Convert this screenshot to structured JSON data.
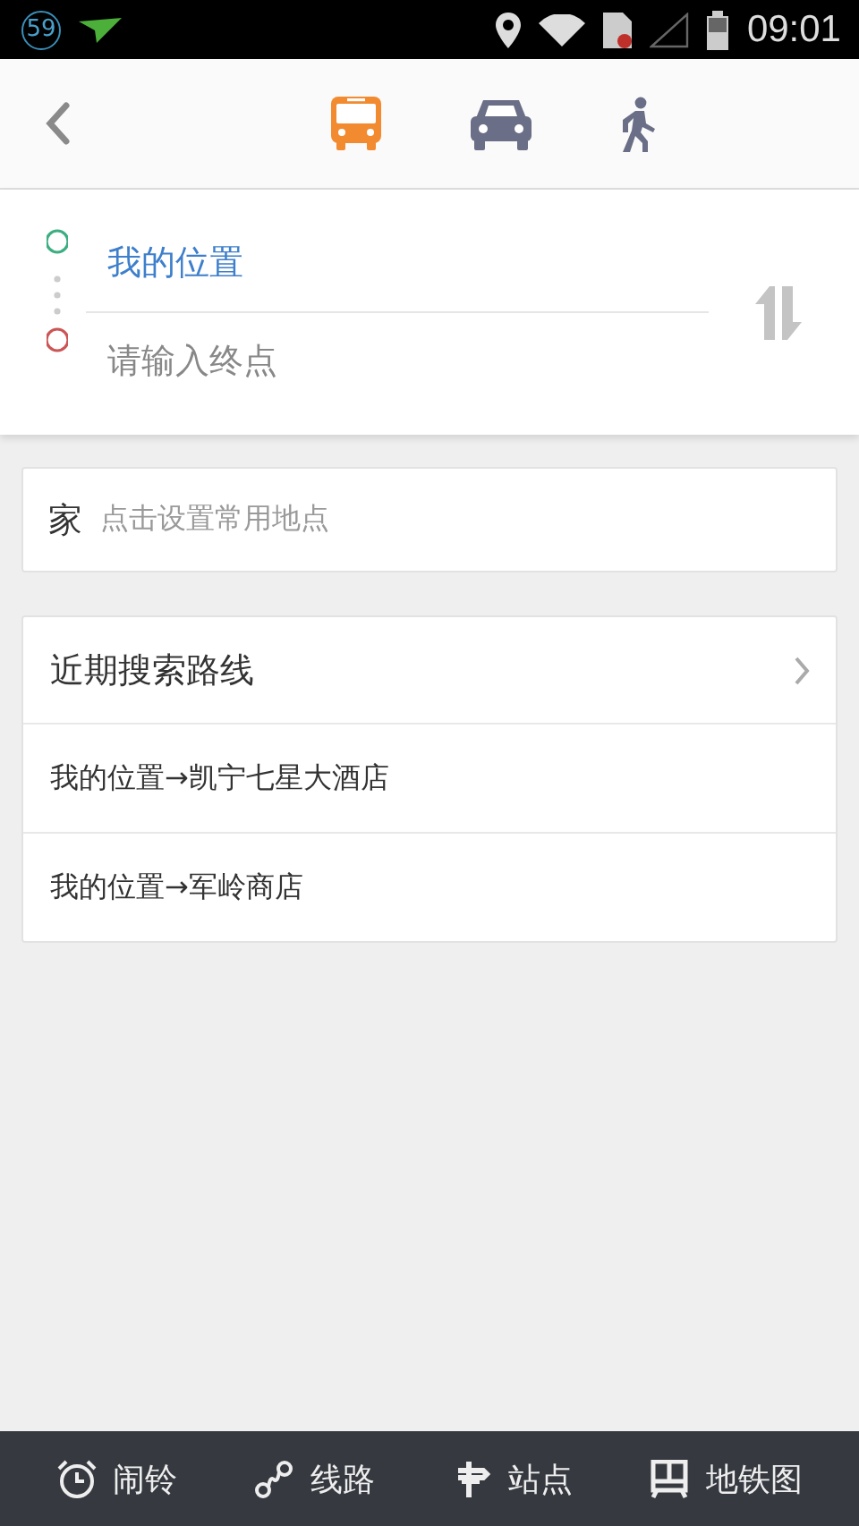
{
  "status_bar": {
    "badge": "59",
    "time": "09:01"
  },
  "modes": [
    {
      "kind": "bus",
      "selected": true
    },
    {
      "kind": "car",
      "selected": false
    },
    {
      "kind": "walk",
      "selected": false
    }
  ],
  "route": {
    "origin": "我的位置",
    "destination": {
      "placeholder": "请输入终点"
    }
  },
  "home": {
    "label": "家",
    "hint": "点击设置常用地点"
  },
  "recent": {
    "title": "近期搜索路线",
    "items": [
      "我的位置→凯宁七星大酒店",
      "我的位置→军岭商店"
    ]
  },
  "bottom_tabs": [
    {
      "kind": "alarm",
      "label": "闹铃"
    },
    {
      "kind": "line",
      "label": "线路"
    },
    {
      "kind": "stop",
      "label": "站点"
    },
    {
      "kind": "metro",
      "label": "地铁图"
    }
  ]
}
